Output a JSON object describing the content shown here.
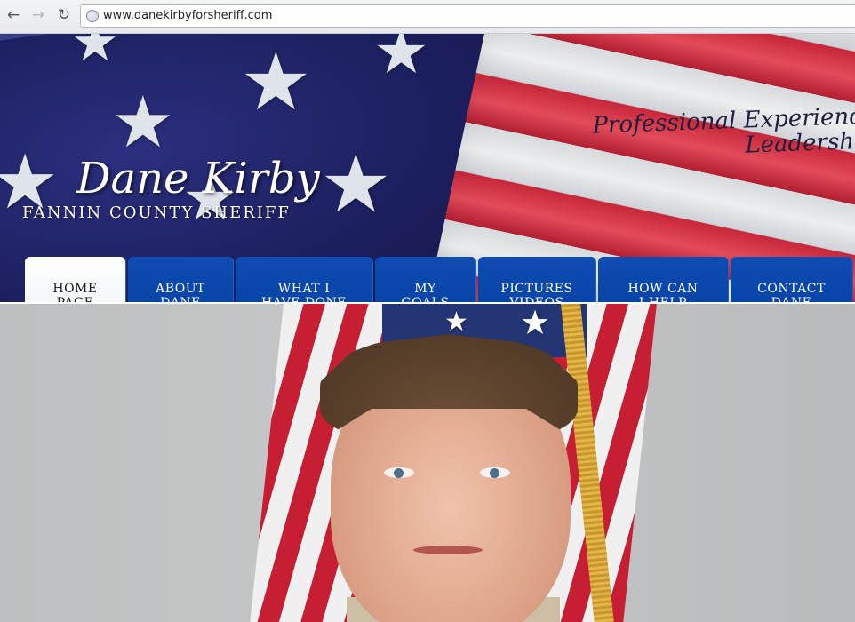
{
  "browser": {
    "back_icon": "back-arrow-icon",
    "forward_icon": "forward-arrow-icon",
    "reload_icon": "reload-icon",
    "url": "www.danekirbyforsheriff.com"
  },
  "header": {
    "title": "Dane Kirby",
    "subtitle": "Fannin County Sheriff",
    "tagline": "Professional Experience\nLeadership"
  },
  "nav": {
    "tabs": [
      {
        "label": "Home\nPage",
        "active": true
      },
      {
        "label": "About\nDane",
        "active": false
      },
      {
        "label": "What I\nHave Done",
        "active": false
      },
      {
        "label": "My\nGoals",
        "active": false
      },
      {
        "label": "Pictures\nVideos",
        "active": false
      },
      {
        "label": "How Can\nI Help",
        "active": false
      },
      {
        "label": "Contact\nDane",
        "active": false
      }
    ]
  },
  "colors": {
    "nav_blue": "#0a47ab",
    "active_tab": "#ffffff",
    "title_white": "#ffffff"
  }
}
